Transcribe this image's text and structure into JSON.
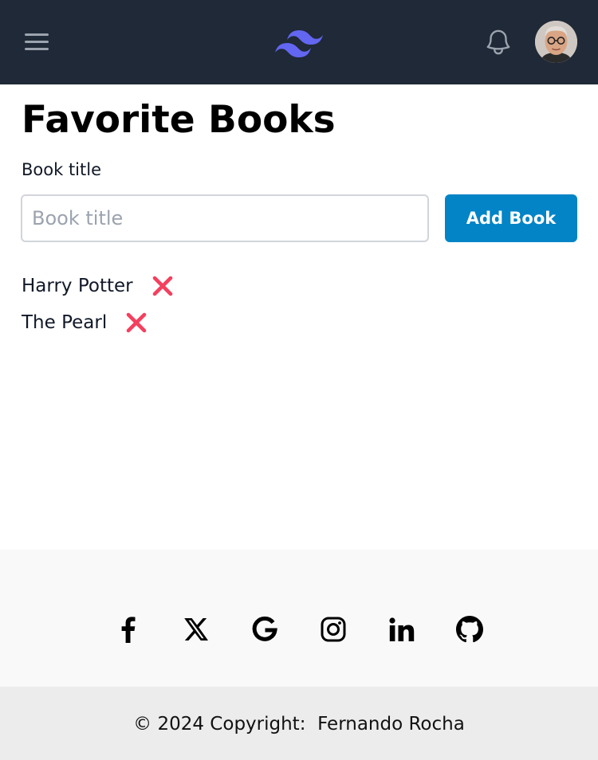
{
  "header": {
    "menu_icon": "hamburger-menu-icon",
    "logo_icon": "tailwind-logo-icon",
    "notification_icon": "bell-icon",
    "avatar": "user-avatar",
    "brand_color": "#6366f1",
    "bar_color": "#1f2937"
  },
  "main": {
    "title": "Favorite Books",
    "input_label": "Book title",
    "input_placeholder": "Book title",
    "input_value": "",
    "add_button_label": "Add Book",
    "add_button_color": "#0284c7",
    "books": [
      {
        "title": "Harry Potter",
        "delete_icon": "x-mark-icon"
      },
      {
        "title": "The Pearl",
        "delete_icon": "x-mark-icon"
      }
    ],
    "delete_color": "#f43f5e"
  },
  "footer": {
    "social_icons": [
      "facebook-icon",
      "x-twitter-icon",
      "google-icon",
      "instagram-icon",
      "linkedin-icon",
      "github-icon"
    ],
    "copyright_prefix": "© 2024 Copyright:",
    "copyright_owner": "Fernando Rocha"
  }
}
